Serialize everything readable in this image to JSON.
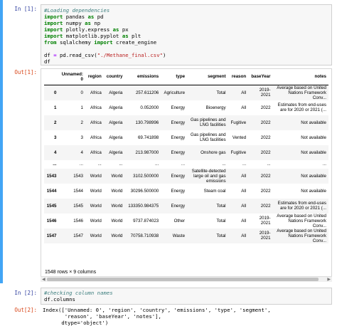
{
  "cell1": {
    "in_prompt": "In [1]:",
    "out_prompt": "Out[1]:",
    "code_lines": [
      {
        "parts": [
          {
            "t": "#Loading dependencies",
            "c": "cm"
          }
        ]
      },
      {
        "parts": [
          {
            "t": "import",
            "c": "kw"
          },
          {
            "t": " pandas ",
            "c": ""
          },
          {
            "t": "as",
            "c": "kw"
          },
          {
            "t": " pd",
            "c": ""
          }
        ]
      },
      {
        "parts": [
          {
            "t": "import",
            "c": "kw"
          },
          {
            "t": " numpy ",
            "c": ""
          },
          {
            "t": "as",
            "c": "kw"
          },
          {
            "t": " np",
            "c": ""
          }
        ]
      },
      {
        "parts": [
          {
            "t": "import",
            "c": "kw"
          },
          {
            "t": " plotly.express ",
            "c": ""
          },
          {
            "t": "as",
            "c": "kw"
          },
          {
            "t": " px",
            "c": ""
          }
        ]
      },
      {
        "parts": [
          {
            "t": "import",
            "c": "kw"
          },
          {
            "t": " matplotlib.pyplot ",
            "c": ""
          },
          {
            "t": "as",
            "c": "kw"
          },
          {
            "t": " plt",
            "c": ""
          }
        ]
      },
      {
        "parts": [
          {
            "t": "from",
            "c": "kw"
          },
          {
            "t": " sqlalchemy ",
            "c": ""
          },
          {
            "t": "import",
            "c": "kw"
          },
          {
            "t": " create_engine",
            "c": ""
          }
        ]
      },
      {
        "parts": [
          {
            "t": "",
            "c": ""
          }
        ]
      },
      {
        "parts": [
          {
            "t": "df ",
            "c": ""
          },
          {
            "t": "=",
            "c": "op"
          },
          {
            "t": " pd.read_csv(",
            "c": ""
          },
          {
            "t": "\"./Methane_final.csv\"",
            "c": "st"
          },
          {
            "t": ")",
            "c": ""
          }
        ]
      },
      {
        "parts": [
          {
            "t": "df",
            "c": ""
          }
        ]
      }
    ]
  },
  "table": {
    "columns": [
      "Unnamed:\n0",
      "region",
      "country",
      "emissions",
      "type",
      "segment",
      "reason",
      "baseYear",
      "notes"
    ],
    "rows": [
      {
        "index": "0",
        "cells": [
          "0",
          "Africa",
          "Algeria",
          "257.611206",
          "Agriculture",
          "Total",
          "All",
          "2019-\n2021",
          "Average based on United\nNations Framework\nConv..."
        ]
      },
      {
        "index": "1",
        "cells": [
          "1",
          "Africa",
          "Algeria",
          "0.052000",
          "Energy",
          "Bioenergy",
          "All",
          "2022",
          "Estimates from end-uses\nare for 2020 or 2021 (..."
        ]
      },
      {
        "index": "2",
        "cells": [
          "2",
          "Africa",
          "Algeria",
          "130.798996",
          "Energy",
          "Gas pipelines and\nLNG facilities",
          "Fugitive",
          "2022",
          "Not available"
        ]
      },
      {
        "index": "3",
        "cells": [
          "3",
          "Africa",
          "Algeria",
          "69.741898",
          "Energy",
          "Gas pipelines and\nLNG facilities",
          "Vented",
          "2022",
          "Not available"
        ]
      },
      {
        "index": "4",
        "cells": [
          "4",
          "Africa",
          "Algeria",
          "213.987000",
          "Energy",
          "Onshore gas",
          "Fugitive",
          "2022",
          "Not available"
        ]
      },
      {
        "index": "...",
        "cells": [
          "...",
          "...",
          "...",
          "...",
          "...",
          "...",
          "...",
          "...",
          "..."
        ]
      },
      {
        "index": "1543",
        "cells": [
          "1543",
          "World",
          "World",
          "3102.500000",
          "Energy",
          "Satellite-detected\nlarge oil and gas\nemissions",
          "All",
          "2022",
          "Not available"
        ]
      },
      {
        "index": "1544",
        "cells": [
          "1544",
          "World",
          "World",
          "30296.500000",
          "Energy",
          "Steam coal",
          "All",
          "2022",
          "Not available"
        ]
      },
      {
        "index": "1545",
        "cells": [
          "1545",
          "World",
          "World",
          "133350.984375",
          "Energy",
          "Total",
          "All",
          "2022",
          "Estimates from end-uses\nare for 2020 or 2021 (..."
        ]
      },
      {
        "index": "1546",
        "cells": [
          "1546",
          "World",
          "World",
          "9737.874023",
          "Other",
          "Total",
          "All",
          "2019-\n2021",
          "Average based on United\nNations Framework\nConv..."
        ]
      },
      {
        "index": "1547",
        "cells": [
          "1547",
          "World",
          "World",
          "70758.710938",
          "Waste",
          "Total",
          "All",
          "2019-\n2021",
          "Average based on United\nNations Framework\nConv..."
        ]
      }
    ],
    "shape": "1548 rows × 9 columns"
  },
  "cell2": {
    "in_prompt": "In [2]:",
    "out_prompt": "Out[2]:",
    "code_lines": [
      {
        "parts": [
          {
            "t": "#checking column names",
            "c": "cm"
          }
        ]
      },
      {
        "parts": [
          {
            "t": "df.columns",
            "c": ""
          }
        ]
      }
    ],
    "output_lines": [
      "Index(['Unnamed: 0', 'region', 'country', 'emissions', 'type', 'segment',",
      "       'reason', 'baseYear', 'notes'],",
      "      dtype='object')"
    ]
  },
  "colors": {
    "selected_cell_bar": "#42a5f5",
    "in_prompt": "#303f9f",
    "out_prompt": "#d84315"
  }
}
